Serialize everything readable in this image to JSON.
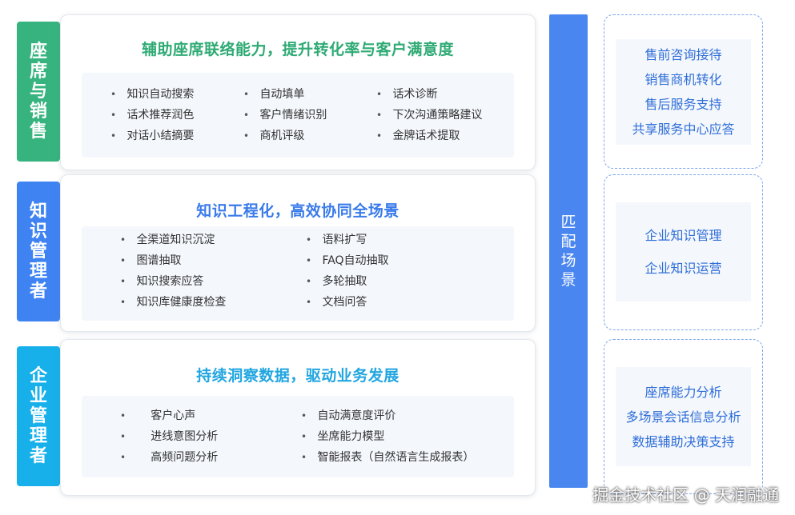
{
  "colors": {
    "sales_tab": "#36b37e",
    "knowledge_tab": "#3f83f3",
    "manager_tab": "#17b0ea",
    "sales_title": "#2eaa74",
    "knowledge_title": "#3a7bea",
    "manager_title": "#22a6e0",
    "match_bar": "#4a86f0",
    "scene_text": "#2f6ed8"
  },
  "sections": [
    {
      "tab_label": "座席与销售",
      "title": "辅助座席联络能力，提升转化率与客户满意度",
      "columns": [
        [
          "知识自动搜索",
          "话术推荐润色",
          "对话小结摘要"
        ],
        [
          "自动填单",
          "客户情绪识别",
          "商机评级"
        ],
        [
          "话术诊断",
          "下次沟通策略建议",
          "金牌话术提取"
        ]
      ]
    },
    {
      "tab_label": "知识管理者",
      "title": "知识工程化，高效协同全场景",
      "columns": [
        [
          "全渠道知识沉淀",
          "图谱抽取",
          "知识搜索应答",
          "知识库健康度检查"
        ],
        [
          "语料扩写",
          "FAQ自动抽取",
          "多轮抽取",
          "文档问答"
        ]
      ]
    },
    {
      "tab_label": "企业管理者",
      "title": "持续洞察数据，驱动业务发展",
      "columns": [
        [
          "客户心声",
          "进线意图分析",
          "高频问题分析"
        ],
        [
          "自动满意度评价",
          "坐席能力模型",
          "智能报表（自然语言生成报表）"
        ]
      ]
    }
  ],
  "match_label": "匹配场景",
  "scenes": [
    [
      "售前咨询接待",
      "销售商机转化",
      "售后服务支持",
      "共享服务中心应答"
    ],
    [
      "企业知识管理",
      "企业知识运营"
    ],
    [
      "座席能力分析",
      "多场景会话信息分析",
      "数据辅助决策支持"
    ]
  ],
  "watermark": "掘金技术社区 @ 天润融通"
}
